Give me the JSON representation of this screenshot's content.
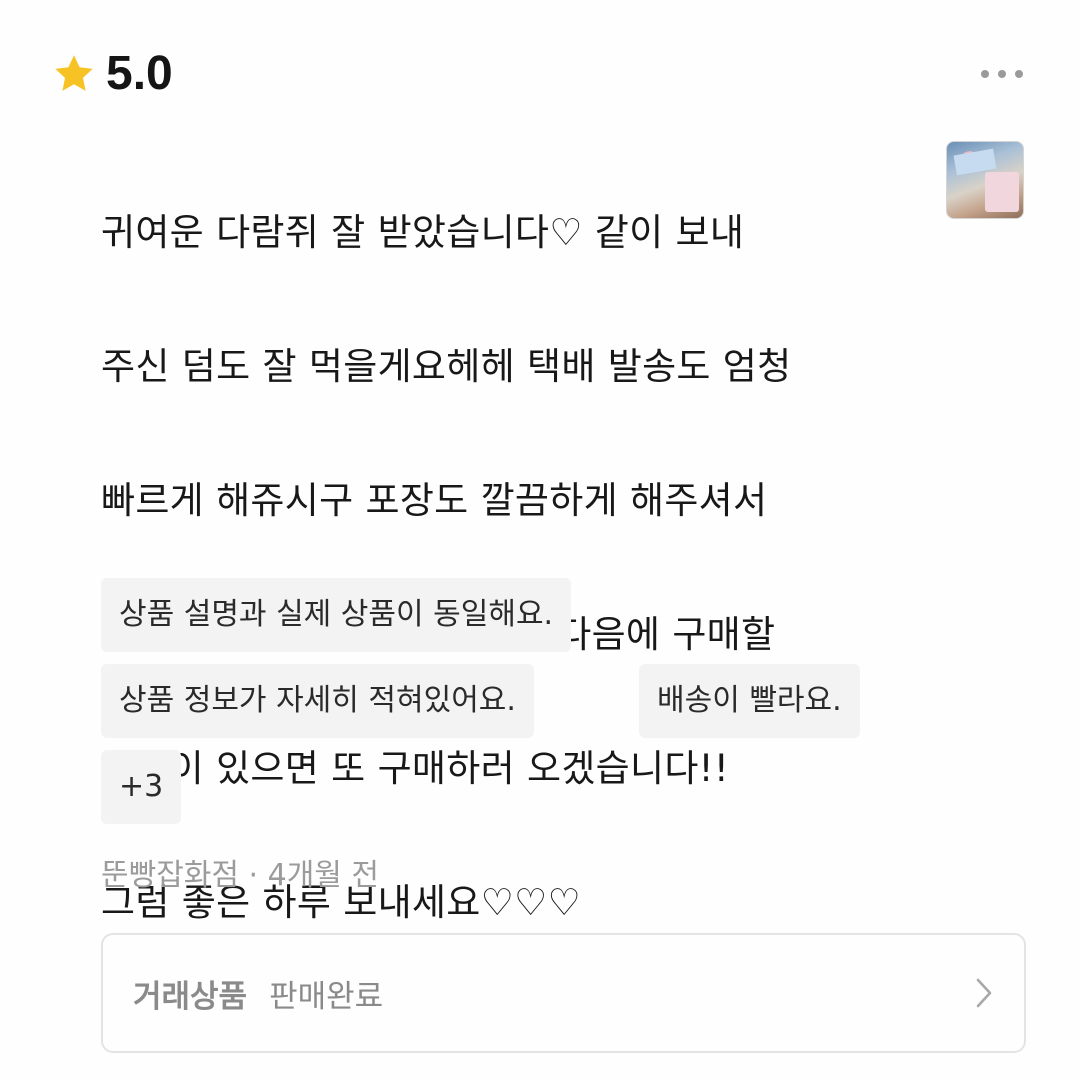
{
  "rating": {
    "value": "5.0",
    "icon": "star-icon",
    "star_color": "#f7c324"
  },
  "menu": {
    "icon": "more-horizontal-icon"
  },
  "review": {
    "lines": [
      "귀여운 다람쥐 잘 받았습니다♡ 같이 보내",
      "주신 덤도 잘 먹을게요헤헤 택배 발송도 엄청",
      "빠르게 해쥬시구 포장도 깔끔하게 해주셔서",
      "개봉할 때 기분이 좋았어요!! 다음에 구매할",
      "물건이 있으면 또 구매하러 오겠습니다!!",
      "그럼 좋은 하루 보내세요♡♡♡"
    ]
  },
  "tags": [
    "상품 설명과 실제 상품이 동일해요.",
    "상품 정보가 자세히 적혀있어요.",
    "배송이 빨라요.",
    "+3"
  ],
  "meta": {
    "author": "뚠빵잡화점",
    "separator": " · ",
    "time": "4개월 전"
  },
  "trade": {
    "label": "거래상품",
    "status": "판매완료",
    "icon": "chevron-right-icon"
  }
}
